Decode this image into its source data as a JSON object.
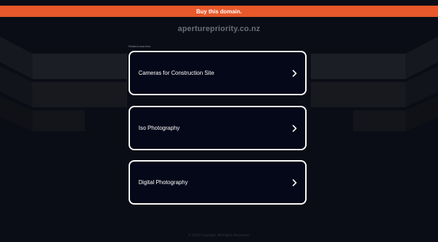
{
  "banner": {
    "buy_label": "Buy this domain."
  },
  "header": {
    "domain": "aperturepriority.co.nz"
  },
  "related": {
    "label": "Related searches",
    "links": [
      {
        "label": "Cameras for Construction Site"
      },
      {
        "label": "Iso Photography"
      },
      {
        "label": "Digital Photography"
      }
    ]
  },
  "footer": {
    "text": "© 2024 Copyright. All Rights Reserved."
  },
  "colors": {
    "background": "#0b0d16",
    "banner": "#e8582a",
    "box_border": "#ffffff",
    "box_fill": "#050818"
  },
  "icons": {
    "chevron": "chevron-right-icon"
  }
}
